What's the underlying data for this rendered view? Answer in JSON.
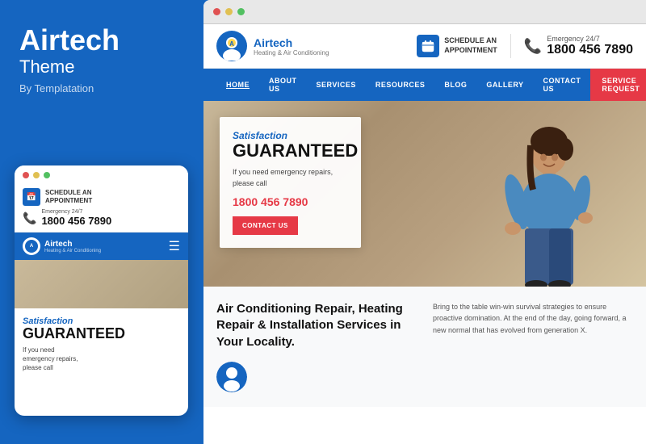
{
  "left": {
    "brand_title": "Airtech",
    "brand_subtitle": "Theme",
    "brand_by": "By Templatation",
    "dots": [
      "red",
      "yellow",
      "green"
    ],
    "mobile": {
      "schedule_label": "SCHEDULE AN",
      "schedule_label2": "APPOINTMENT",
      "emergency_label": "Emergency 24/7",
      "phone_number": "1800 456 7890",
      "brand_name": "Airtech",
      "brand_tagline": "Heating & Air Conditioning",
      "satisfaction_italic": "Satisfaction",
      "guaranteed": "GUARANTEED",
      "desc_line1": "If you need",
      "desc_line2": "emergency repairs,",
      "desc_line3": "please call"
    }
  },
  "right": {
    "browser_dots": [
      "red",
      "yellow",
      "green"
    ],
    "header": {
      "brand_name": "Airtech",
      "brand_tagline": "Heating & Air Conditioning",
      "schedule_label": "SCHEDULE AN",
      "schedule_label2": "APPOINTMENT",
      "emergency_label": "Emergency 24/7",
      "phone_number": "1800 456 7890"
    },
    "nav": {
      "items": [
        "HOME",
        "ABOUT US",
        "SERVICES",
        "RESOURCES",
        "BLOG",
        "GALLERY",
        "CONTACT US"
      ],
      "active": "HOME",
      "cta": "SERVICE REQUEST"
    },
    "hero": {
      "satisfaction_italic": "Satisfaction",
      "guaranteed": "GUARANTEED",
      "desc": "If you need emergency repairs, please call",
      "phone": "1800 456 7890",
      "cta_btn": "CONTACT US"
    },
    "below": {
      "title": "Air Conditioning Repair, Heating Repair & Installation Services in Your Locality.",
      "desc": "Bring to the table win-win survival strategies to ensure proactive domination. At the end of the day, going forward, a new normal that has evolved from generation X."
    }
  }
}
